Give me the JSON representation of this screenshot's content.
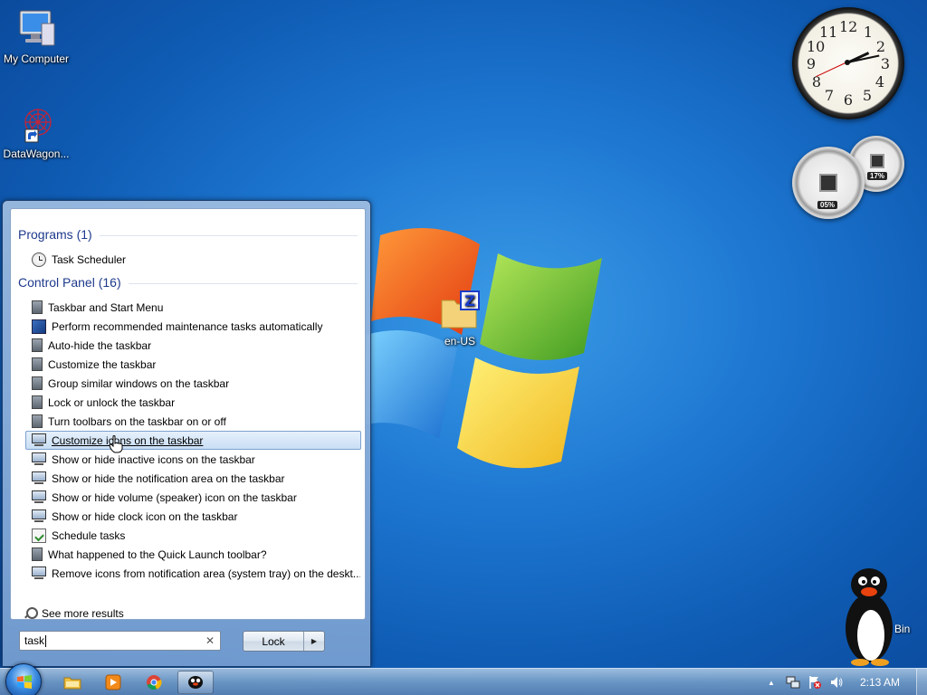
{
  "desktop": {
    "icons": [
      {
        "label": "My Computer",
        "icon": "computer-icon"
      },
      {
        "label": "DataWagon...",
        "icon": "datawagon-shortcut-icon"
      },
      {
        "label": "en-US",
        "icon": "zip-folder-icon"
      },
      {
        "label": "Bin",
        "icon": "recycle-bin-penguin-icon"
      }
    ]
  },
  "gadgets": {
    "clock": {
      "numbers": [
        "12",
        "1",
        "2",
        "3",
        "4",
        "5",
        "6",
        "7",
        "8",
        "9",
        "10",
        "11"
      ],
      "time": "2:13"
    },
    "cpu_meter": {
      "cpu_label": "05%",
      "memory_label": "17%"
    }
  },
  "start_menu": {
    "programs": {
      "header": "Programs (1)",
      "items": [
        {
          "label": "Task Scheduler",
          "icon": "clock-icon"
        }
      ]
    },
    "control_panel": {
      "header": "Control Panel (16)",
      "items": [
        {
          "label": "Taskbar and Start Menu",
          "icon": "taskbar-settings-icon"
        },
        {
          "label": "Perform recommended maintenance tasks automatically",
          "icon": "maintenance-icon"
        },
        {
          "label": "Auto-hide the taskbar",
          "icon": "taskbar-settings-icon"
        },
        {
          "label": "Customize the taskbar",
          "icon": "taskbar-settings-icon"
        },
        {
          "label": "Group similar windows on the taskbar",
          "icon": "taskbar-settings-icon"
        },
        {
          "label": "Lock or unlock the taskbar",
          "icon": "taskbar-settings-icon"
        },
        {
          "label": "Turn toolbars on the taskbar on or off",
          "icon": "taskbar-settings-icon"
        },
        {
          "label": "Customize icons on the taskbar",
          "icon": "notification-area-icon",
          "selected": true
        },
        {
          "label": "Show or hide inactive icons on the taskbar",
          "icon": "notification-area-icon"
        },
        {
          "label": "Show or hide the notification area on the taskbar",
          "icon": "notification-area-icon"
        },
        {
          "label": "Show or hide volume (speaker) icon on the taskbar",
          "icon": "notification-area-icon"
        },
        {
          "label": "Show or hide clock icon on the taskbar",
          "icon": "notification-area-icon"
        },
        {
          "label": "Schedule tasks",
          "icon": "schedule-icon"
        },
        {
          "label": "What happened to the Quick Launch toolbar?",
          "icon": "taskbar-settings-icon"
        },
        {
          "label": "Remove icons from notification area (system tray) on the deskt...",
          "icon": "notification-area-icon"
        }
      ]
    },
    "see_more": "See more results",
    "search": {
      "value": "task",
      "clear_glyph": "✕"
    },
    "power_button": {
      "label": "Lock",
      "arrow": "▶"
    }
  },
  "taskbar": {
    "pinned": [
      {
        "name": "explorer",
        "icon": "folder-icon"
      },
      {
        "name": "media-player",
        "icon": "media-player-icon"
      },
      {
        "name": "chrome",
        "icon": "chrome-icon"
      },
      {
        "name": "penguin-app",
        "icon": "penguin-icon",
        "active": true
      }
    ],
    "tray": {
      "expand_glyph": "▲",
      "time": "2:13 AM"
    }
  },
  "colors": {
    "accent": "#1e3a8c",
    "selection": "#c9def5",
    "desktop": "#1e78d2"
  }
}
